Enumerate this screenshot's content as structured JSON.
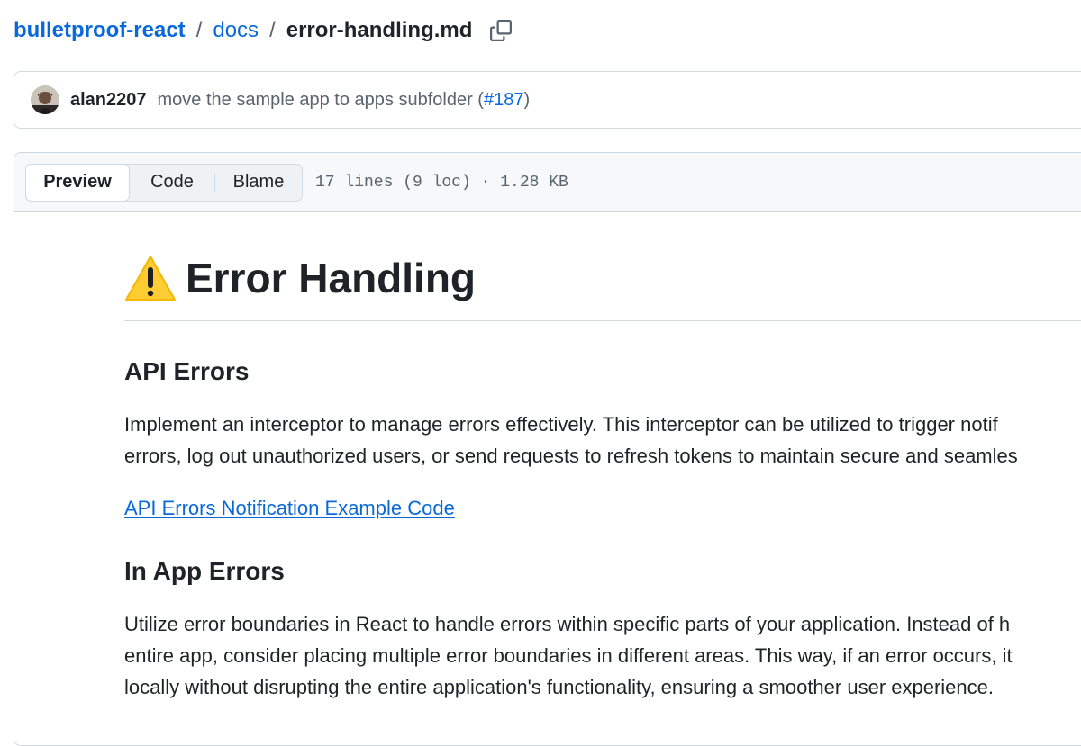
{
  "breadcrumb": {
    "repo": "bulletproof-react",
    "folder": "docs",
    "separator": "/",
    "file": "error-handling.md",
    "copy_icon": "copy-icon"
  },
  "commit": {
    "author": "alan2207",
    "message": "move the sample app to apps subfolder (",
    "pr": "#187",
    "message_end": ")"
  },
  "file_header": {
    "tabs": [
      {
        "label": "Preview",
        "active": true
      },
      {
        "label": "Code",
        "active": false
      },
      {
        "label": "Blame",
        "active": false
      }
    ],
    "meta": "17 lines (9 loc) · 1.28 KB"
  },
  "markdown": {
    "title": "Error Handling",
    "title_icon": "warning-icon",
    "section1": {
      "heading": "API Errors",
      "lines": [
        "Implement an interceptor to manage errors effectively. This interceptor can be utilized to trigger notif",
        "errors, log out unauthorized users, or send requests to refresh tokens to maintain secure and seamles"
      ],
      "link": "API Errors Notification Example Code"
    },
    "section2": {
      "heading": "In App Errors",
      "lines": [
        "Utilize error boundaries in React to handle errors within specific parts of your application. Instead of h",
        "entire app, consider placing multiple error boundaries in different areas. This way, if an error occurs, it",
        "locally without disrupting the entire application's functionality, ensuring a smoother user experience."
      ]
    }
  },
  "colors": {
    "link": "#0969da",
    "text": "#1f2328",
    "muted": "#59636e",
    "border": "#d1d9e0",
    "header_bg": "#f6f8fa"
  }
}
